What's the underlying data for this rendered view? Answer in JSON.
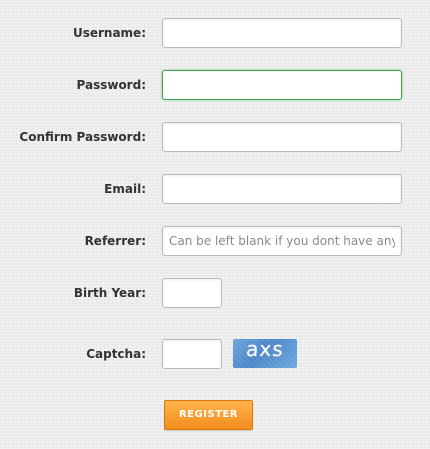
{
  "form": {
    "fields": {
      "username": {
        "label": "Username:",
        "value": "",
        "placeholder": ""
      },
      "password": {
        "label": "Password:",
        "value": "",
        "placeholder": ""
      },
      "confirm_password": {
        "label": "Confirm Password:",
        "value": "",
        "placeholder": ""
      },
      "email": {
        "label": "Email:",
        "value": "",
        "placeholder": ""
      },
      "referrer": {
        "label": "Referrer:",
        "value": "",
        "placeholder": "Can be left blank if you dont have any."
      },
      "birth_year": {
        "label": "Birth Year:",
        "value": "",
        "placeholder": ""
      },
      "captcha": {
        "label": "Captcha:",
        "value": "",
        "placeholder": "",
        "image_text": "axs"
      }
    },
    "register_label": "REGISTER"
  },
  "colors": {
    "background": "#ececec",
    "focus_border": "#3fa84b",
    "button_accent": "#f28d1c",
    "captcha_blue": "#4d87c9"
  }
}
